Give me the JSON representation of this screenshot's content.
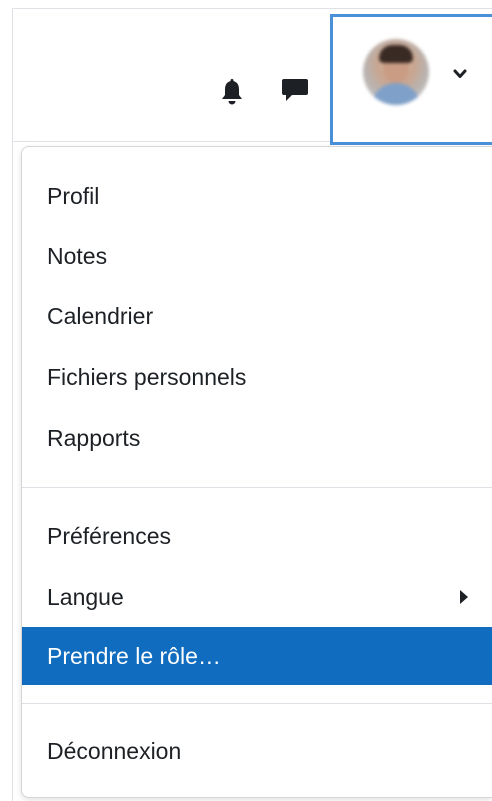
{
  "navbar": {
    "icons": {
      "notifications": "bell-icon",
      "messages": "chat-bubble-icon",
      "user_menu_caret": "chevron-down-icon"
    },
    "colors": {
      "focus_border": "#4a90d9",
      "icon": "#1d2125"
    }
  },
  "user_menu": {
    "items": [
      {
        "label": "Profil"
      },
      {
        "label": "Notes"
      },
      {
        "label": "Calendrier"
      },
      {
        "label": "Fichiers personnels"
      },
      {
        "label": "Rapports"
      },
      {
        "label": "Préférences"
      },
      {
        "label": "Langue",
        "has_submenu": true
      },
      {
        "label": "Prendre le rôle…",
        "active": true
      },
      {
        "label": "Déconnexion"
      }
    ],
    "colors": {
      "active_background": "#0f6cbf",
      "active_text": "#ffffff",
      "text": "#1d2125"
    }
  }
}
